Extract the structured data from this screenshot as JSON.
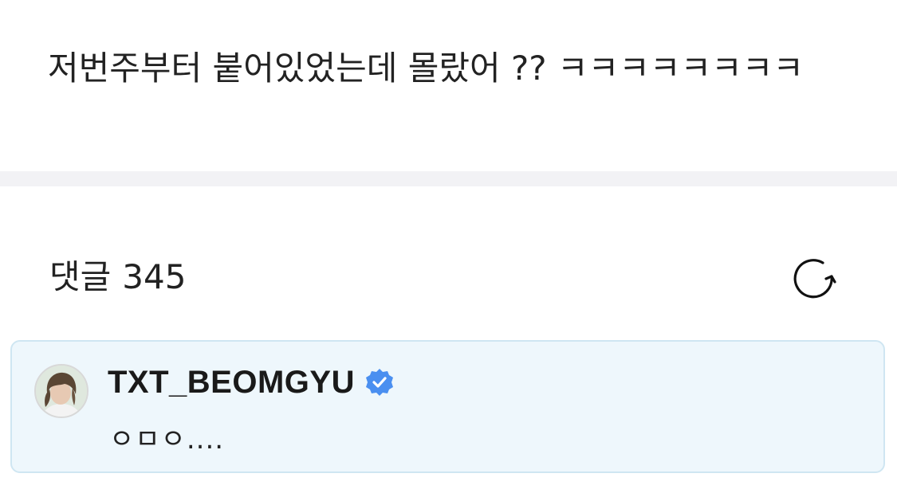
{
  "post": {
    "text": "저번주부터 붙어있었는데 몰랐어 ?? ㅋㅋㅋㅋㅋㅋㅋㅋ"
  },
  "comments": {
    "title": "댓글",
    "count": "345",
    "refresh_icon": "refresh-icon"
  },
  "featured_comment": {
    "author": "TXT_BEOMGYU",
    "verified_icon": "verified-badge-icon",
    "text": "ㅇㅁㅇ....",
    "accent_color": "#4a8ff0",
    "background_color": "#eef7fc",
    "border_color": "#cfe6f2"
  }
}
